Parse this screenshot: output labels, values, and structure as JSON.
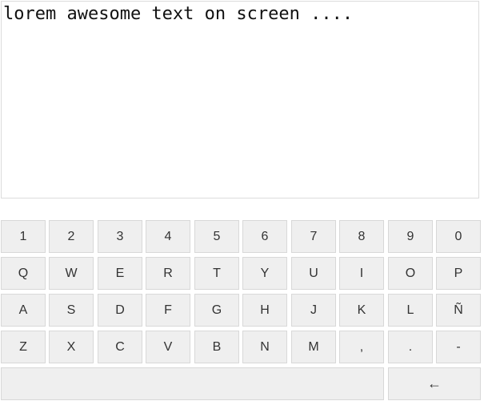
{
  "editor": {
    "text": "lorem awesome text on screen ...."
  },
  "keyboard": {
    "rows": [
      [
        "1",
        "2",
        "3",
        "4",
        "5",
        "6",
        "7",
        "8",
        "9",
        "0"
      ],
      [
        "Q",
        "W",
        "E",
        "R",
        "T",
        "Y",
        "U",
        "I",
        "O",
        "P"
      ],
      [
        "A",
        "S",
        "D",
        "F",
        "G",
        "H",
        "J",
        "K",
        "L",
        "Ñ"
      ],
      [
        "Z",
        "X",
        "C",
        "V",
        "B",
        "N",
        "M",
        ",",
        ".",
        "-"
      ]
    ],
    "space_label": "",
    "backspace_icon": "arrow-left-icon",
    "backspace_glyph": "←"
  },
  "colors": {
    "key_background": "#efefef",
    "key_border": "#d8d8d8",
    "text": "#111111"
  }
}
